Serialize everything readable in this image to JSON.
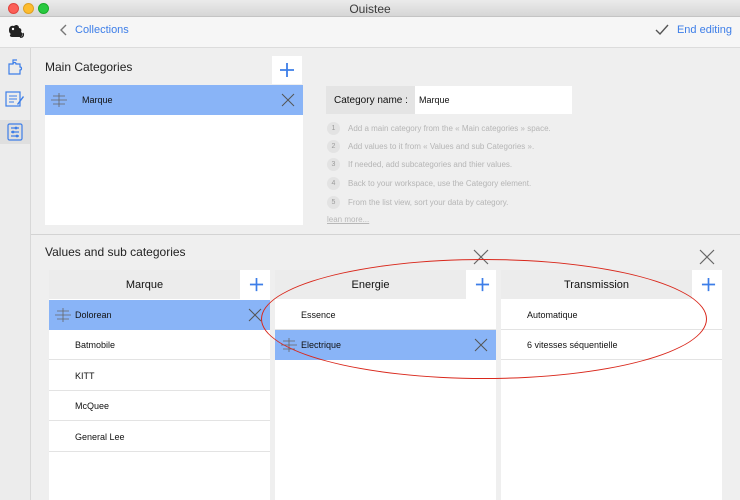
{
  "window": {
    "title": "Ouistee"
  },
  "toolbar": {
    "back_label": "Collections",
    "end_label": "End editing"
  },
  "sidebar": {
    "items": [
      {
        "icon": "puzzle-icon"
      },
      {
        "icon": "edit-list-icon"
      },
      {
        "icon": "category-list-icon",
        "active": true
      }
    ]
  },
  "main_categories": {
    "title": "Main Categories",
    "items": [
      {
        "label": "Marque",
        "selected": true
      }
    ]
  },
  "category_name": {
    "label": "Category name :",
    "value": "Marque"
  },
  "steps": [
    {
      "num": "1",
      "text": "Add a main category from the « Main categories » space."
    },
    {
      "num": "2",
      "text": "Add values to it from « Values and sub Categories »."
    },
    {
      "num": "3",
      "text": "If needed, add subcategories and thier values."
    },
    {
      "num": "4",
      "text": "Back to your workspace, use the Category element."
    },
    {
      "num": "5",
      "text": "From the list view, sort your data by category."
    }
  ],
  "learn_more": "lean more...",
  "values": {
    "title": "Values and sub categories",
    "columns": [
      {
        "header": "Marque",
        "items": [
          "Dolorean",
          "Batmobile",
          "KITT",
          "McQuee",
          "General Lee"
        ],
        "selected": 0
      },
      {
        "header": "Energie",
        "items": [
          "Essence",
          "Electrique"
        ],
        "selected": 1
      },
      {
        "header": "Transmission",
        "items": [
          "Automatique",
          "6 vitesses séquentielle"
        ],
        "selected": -1
      }
    ]
  },
  "colors": {
    "accent": "#3d7ee8",
    "selection": "#89b4f7",
    "annotation": "#d9281c"
  }
}
